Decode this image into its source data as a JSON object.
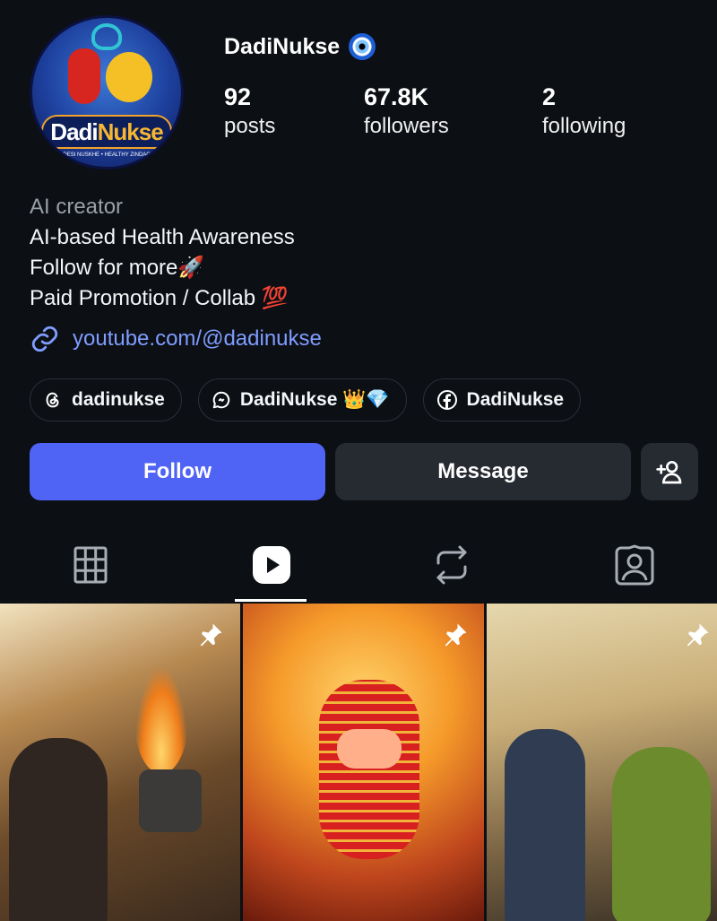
{
  "profile": {
    "username": "DadiNukse",
    "verified_icon": "nazar-eye-icon",
    "avatar": {
      "brand_part1": "Dadi",
      "brand_part2": "Nukse",
      "tagline": "DESI NUSKHE • HEALTHY ZINDAGI"
    },
    "stats": [
      {
        "value": "92",
        "label": "posts"
      },
      {
        "value": "67.8K",
        "label": "followers"
      },
      {
        "value": "2",
        "label": "following"
      }
    ]
  },
  "bio": {
    "category": "AI creator",
    "lines": [
      "AI-based Health Awareness",
      "Follow for more🚀",
      "Paid Promotion / Collab 💯"
    ],
    "link": "youtube.com/@dadinukse"
  },
  "chips": [
    {
      "icon": "threads-icon",
      "label": "dadinukse"
    },
    {
      "icon": "chat-icon",
      "label": "DadiNukse 👑💎"
    },
    {
      "icon": "facebook-icon",
      "label": "DadiNukse"
    }
  ],
  "actions": {
    "follow": "Follow",
    "message": "Message",
    "add_user_icon": "add-user-icon"
  },
  "tabs": [
    {
      "icon": "grid-icon",
      "active": false
    },
    {
      "icon": "reels-icon",
      "active": true
    },
    {
      "icon": "repost-icon",
      "active": false
    },
    {
      "icon": "tagged-icon",
      "active": false
    }
  ],
  "colors": {
    "background": "#0c0f14",
    "accent": "#4f63f5",
    "link": "#7f9dff",
    "secondary_button": "#262a31"
  },
  "posts": [
    {
      "pinned": true,
      "icon": "pin-icon"
    },
    {
      "pinned": true,
      "icon": "pin-icon"
    },
    {
      "pinned": true,
      "icon": "pin-icon"
    }
  ]
}
